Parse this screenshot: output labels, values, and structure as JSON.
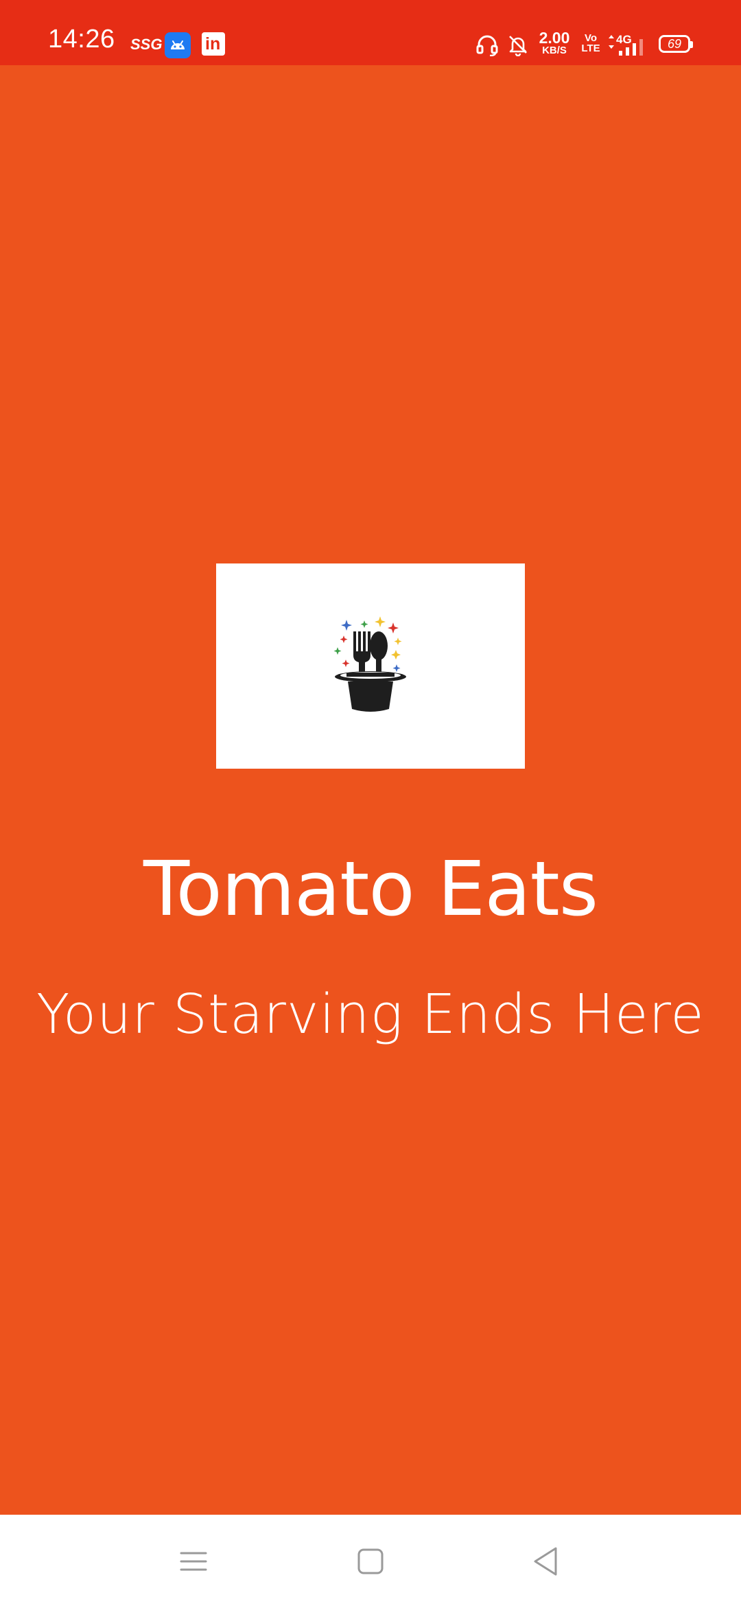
{
  "status_bar": {
    "time": "14:26",
    "carrier_badge": "SSG",
    "notification_icons": [
      "android-icon",
      "linkedin-icon"
    ],
    "linkedin_text": "in",
    "net_speed_value": "2.00",
    "net_speed_unit": "KB/S",
    "volte_line1": "Vo",
    "volte_line2": "LTE",
    "network_type": "4G",
    "battery_level": "69",
    "colors": {
      "background": "#E62D15",
      "android_badge": "#1F7AF2"
    }
  },
  "splash": {
    "background_color": "#ED531D",
    "logo_icon": "magic-hat-fork-spoon-logo",
    "title": "Tomato Eats",
    "tagline": "Your Starving Ends Here"
  },
  "nav_bar": {
    "buttons": [
      "menu-icon",
      "home-icon",
      "back-icon"
    ]
  }
}
